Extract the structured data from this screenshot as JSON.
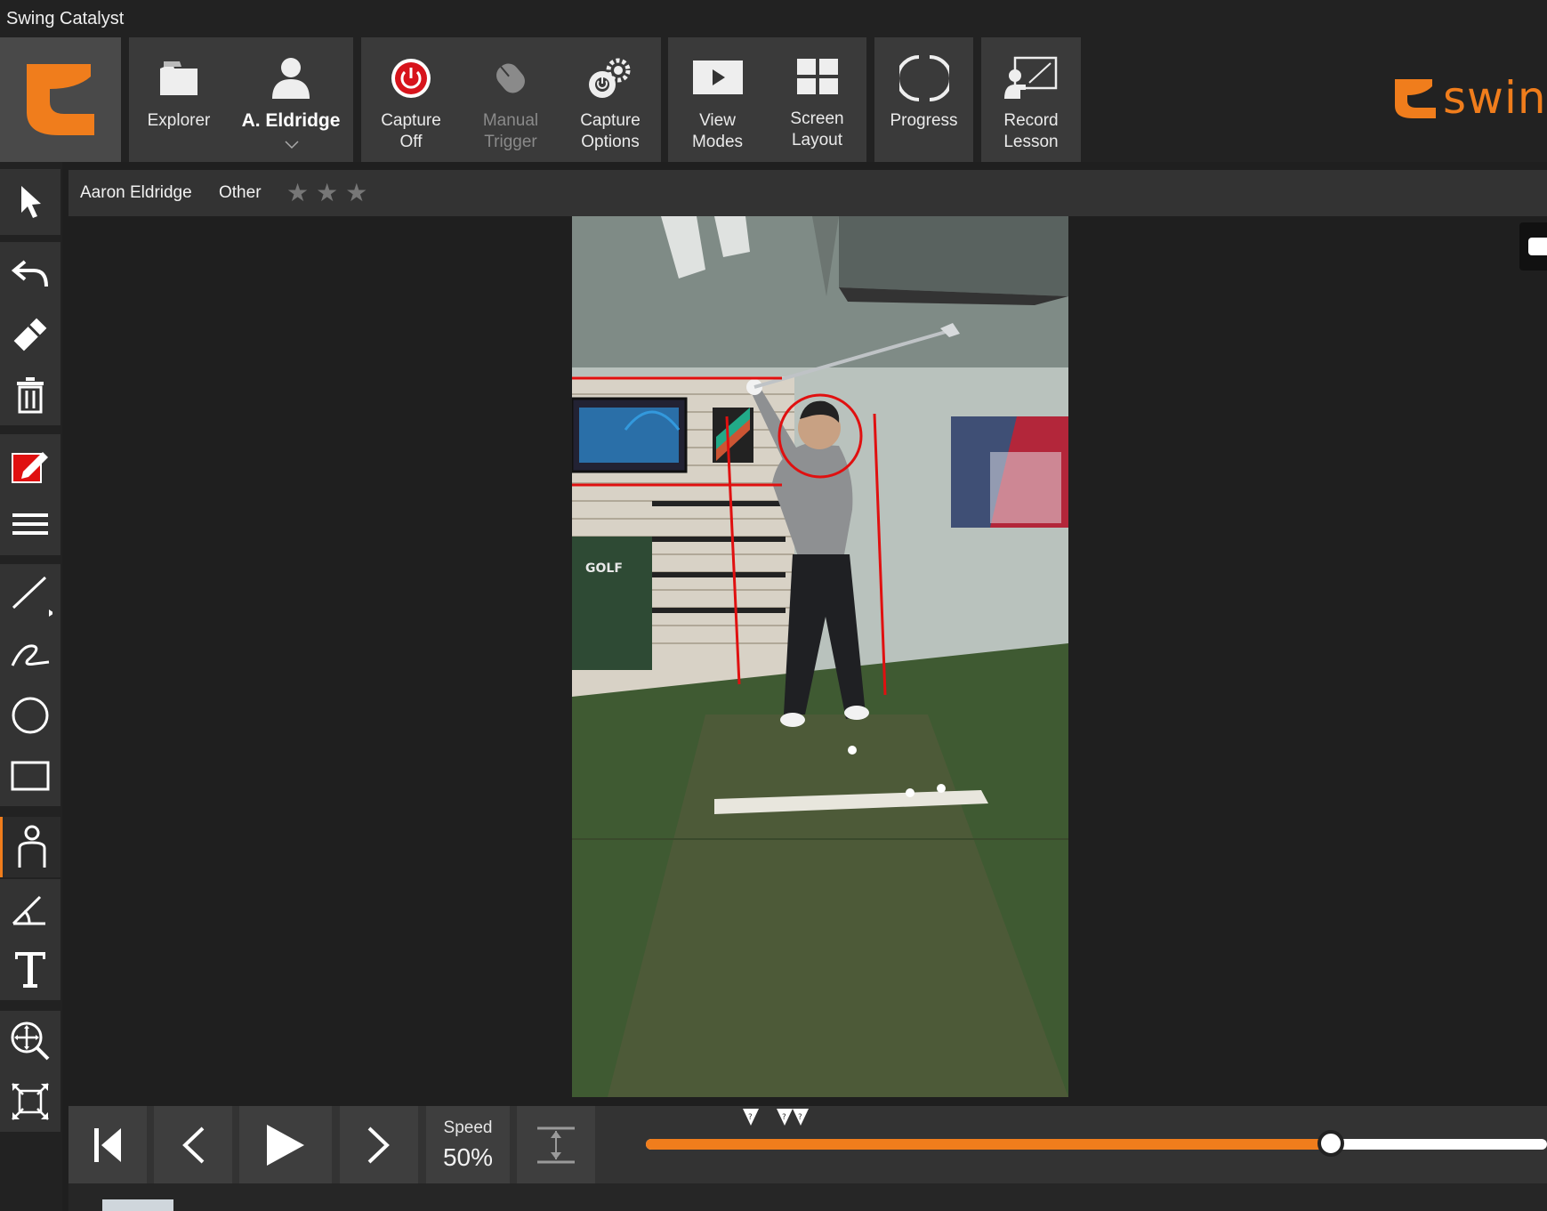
{
  "window": {
    "title": "Swing Catalyst"
  },
  "ribbon": {
    "buttons": [
      {
        "id": "explorer",
        "label": "Explorer",
        "icon": "folder-icon"
      },
      {
        "id": "athlete",
        "label": "A. Eldridge",
        "icon": "person-icon"
      },
      {
        "id": "capture",
        "label": "Capture\nOff",
        "icon": "power-icon"
      },
      {
        "id": "manual",
        "label": "Manual\nTrigger",
        "icon": "mouse-icon",
        "disabled": true
      },
      {
        "id": "capopts",
        "label": "Capture\nOptions",
        "icon": "gears-icon"
      },
      {
        "id": "viewmodes",
        "label": "View\nModes",
        "icon": "play-screen-icon"
      },
      {
        "id": "layout",
        "label": "Screen\nLayout",
        "icon": "grid-icon"
      },
      {
        "id": "progress",
        "label": "Progress",
        "icon": "circle-progress-icon"
      },
      {
        "id": "record",
        "label": "Record\nLesson",
        "icon": "lesson-icon"
      }
    ],
    "brand": "swing"
  },
  "info": {
    "athlete_name": "Aaron Eldridge",
    "category": "Other",
    "rating_stars": "★★★"
  },
  "playback": {
    "speed_label": "Speed",
    "speed_value": "50%",
    "progress_fraction": 0.76
  },
  "colors": {
    "accent": "#f07d1c",
    "capture_red": "#d7141c",
    "drawing_red": "#e01010"
  }
}
